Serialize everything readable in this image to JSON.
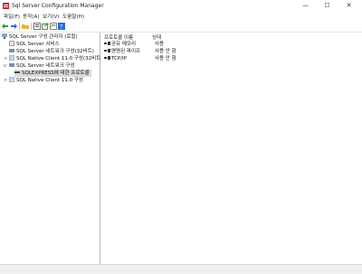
{
  "window": {
    "title": "Sql Server Configuration Manager",
    "minimize_glyph": "—",
    "maximize_glyph": "☐",
    "close_glyph": "✕"
  },
  "menu": {
    "items": [
      "파일(F)",
      "동작(A)",
      "보기(V)",
      "도움말(H)"
    ]
  },
  "toolbar": {
    "icons": [
      "back-arrow-icon",
      "forward-arrow-icon",
      "folder-icon",
      "properties-icon",
      "export-icon",
      "refresh-icon",
      "help-icon"
    ]
  },
  "tree": {
    "items": [
      {
        "label": "SQL Server 구성 관리자 (로컬)",
        "icon": "server-computer-icon",
        "level": 0,
        "expander": ""
      },
      {
        "label": "SQL Server 서비스",
        "icon": "services-icon",
        "level": 1,
        "expander": ""
      },
      {
        "label": "SQL Server 네트워크 구성(32비트)",
        "icon": "network-icon",
        "level": 1,
        "expander": ""
      },
      {
        "label": "SQL Native Client 11.0 구성(32비트)",
        "icon": "client-icon",
        "level": 1,
        "expander": ">"
      },
      {
        "label": "SQL Server 네트워크 구성",
        "icon": "network-icon",
        "level": 1,
        "expander": "v"
      },
      {
        "label": "SQLEXPRESS에 대한 프로토콜",
        "icon": "protocol-icon",
        "level": 2,
        "expander": "",
        "selected": true
      },
      {
        "label": "SQL Native Client 11.0 구성",
        "icon": "client-icon",
        "level": 1,
        "expander": ">"
      }
    ]
  },
  "protocols": {
    "headers": {
      "name": "프로토콜 이름",
      "state": "상태"
    },
    "rows": [
      {
        "name": "공유 메모리",
        "state": "사용"
      },
      {
        "name": "명명된 파이프",
        "state": "사용 안 함"
      },
      {
        "name": "TCP/IP",
        "state": "사용 안 함"
      }
    ]
  },
  "colors": {
    "selection": "#d9d9d9",
    "divider": "#b9b9b9",
    "accent_green": "#3a9a3a",
    "accent_blue": "#2a6fd6"
  }
}
